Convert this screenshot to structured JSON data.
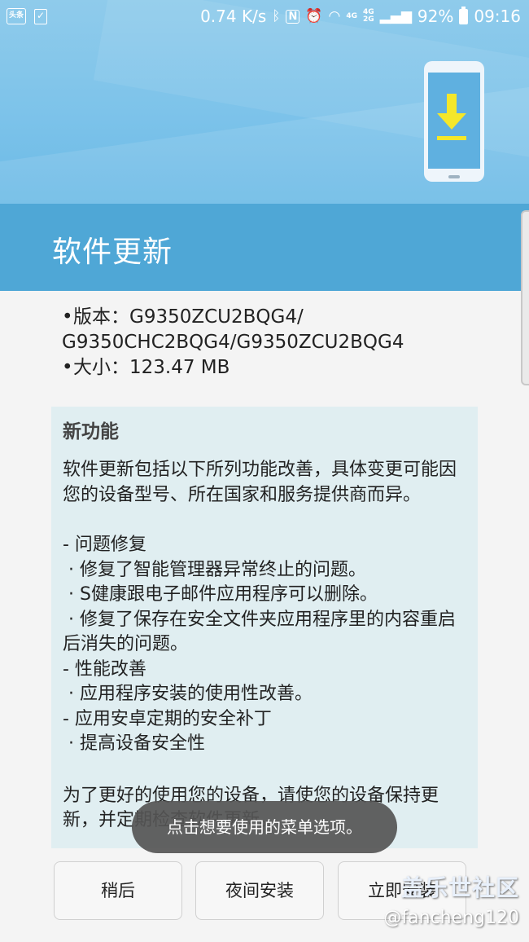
{
  "status_bar": {
    "left_icons": [
      "toutiao-app-icon",
      "checklist-icon"
    ],
    "app_icon_text": "头条",
    "speed": "0.74 K/s",
    "network_top": "4G",
    "network_bottom": "2G",
    "network_main": "4G",
    "battery": "92%",
    "time": "09:16"
  },
  "page": {
    "title": "软件更新"
  },
  "info": {
    "version_line1": "版本：G9350ZCU2BQG4/",
    "version_line2": "G9350CHC2BQG4/G9350ZCU2BQG4",
    "size": "大小：123.47 MB"
  },
  "notes": {
    "heading": "新功能",
    "intro": "软件更新包括以下所列功能改善，具体变更可能因您的设备型号、所在国家和服务提供商而异。",
    "items": [
      "- 问题修复",
      " · 修复了智能管理器异常终止的问题。",
      " · S健康跟电子邮件应用程序可以删除。",
      " · 修复了保存在安全文件夹应用程序里的内容重启后消失的问题。",
      "- 性能改善",
      " · 应用程序安装的使用性改善。",
      "- 应用安卓定期的安全补丁",
      " · 提高设备安全性"
    ],
    "outro": "为了更好的使用您的设备，请使您的设备保持更新，并定期检查软件更新。"
  },
  "toast": {
    "text": "点击想要使用的菜单选项。"
  },
  "buttons": {
    "later": "稍后",
    "night": "夜间安装",
    "now": "立即安装"
  },
  "watermark": {
    "main": "盖乐世社区",
    "sub": "@fancheng120"
  },
  "colors": {
    "title_bar": "#4fa7d6",
    "notes_bg": "#e0eef1",
    "hero": "#7dc3ea",
    "download_arrow": "#f4e72a"
  }
}
